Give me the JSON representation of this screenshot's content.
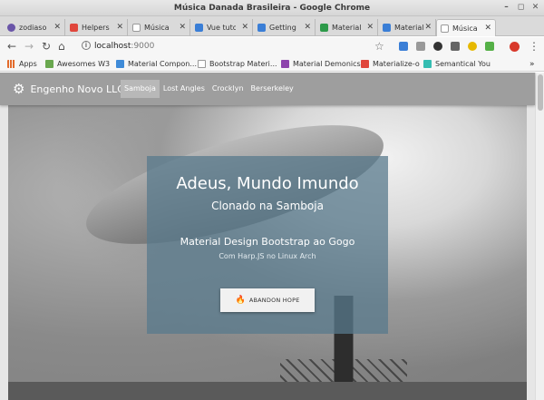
{
  "window": {
    "title": "Música Danada Brasileira - Google Chrome"
  },
  "tabs": [
    {
      "label": "zodiaso",
      "fav_color": "#6a55a8"
    },
    {
      "label": "Helpers",
      "fav_color": "#e0463c"
    },
    {
      "label": "Música",
      "fav_color": "#aaaaaa"
    },
    {
      "label": "Vue tuto",
      "fav_color": "#3a7ed6"
    },
    {
      "label": "Getting",
      "fav_color": "#3a7ed6"
    },
    {
      "label": "Material",
      "fav_color": "#2d9a4a"
    },
    {
      "label": "Material",
      "fav_color": "#3a7ed6"
    },
    {
      "label": "Música",
      "fav_color": "#aaaaaa",
      "active": true
    }
  ],
  "address": {
    "host": "localhost",
    "port": ":9000"
  },
  "bookmarks": [
    {
      "label": "Apps",
      "color": "#e36b2c"
    },
    {
      "label": "Awesomes W3",
      "color": "#6aa84f"
    },
    {
      "label": "Material Compon...",
      "color": "#3f8bd8"
    },
    {
      "label": "Bootstrap Materi...",
      "color": "#bbbbbb"
    },
    {
      "label": "Material Demonics",
      "color": "#8e44ad"
    },
    {
      "label": "Materialize-o",
      "color": "#e0463c"
    },
    {
      "label": "Semantical You",
      "color": "#35bdb2"
    }
  ],
  "site": {
    "brand": "Engenho Novo LLC",
    "nav": [
      "Samboja",
      "Lost Angles",
      "Crocklyn",
      "Berserkeley"
    ],
    "hero": {
      "title": "Adeus, Mundo Imundo",
      "subtitle": "Clonado na Samboja",
      "tagline": "Material Design Bootstrap ao Gogo",
      "note": "Com Harp.JS no Linux Arch",
      "button": "ABANDON HOPE"
    }
  }
}
